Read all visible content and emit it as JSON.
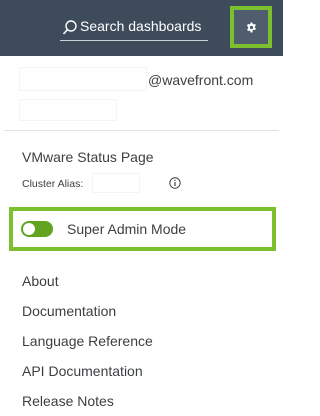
{
  "header": {
    "search_placeholder": "Search dashboards",
    "settings_icon": "gear-icon"
  },
  "account": {
    "email_suffix": "@wavefront.com"
  },
  "status": {
    "status_page_label": "VMware Status Page",
    "cluster_alias_label": "Cluster Alias:"
  },
  "admin_mode": {
    "label": "Super Admin Mode",
    "enabled": true
  },
  "menu_links": [
    "About",
    "Documentation",
    "Language Reference",
    "API Documentation",
    "Release Notes"
  ],
  "colors": {
    "topbar": "#3e4b5b",
    "highlight": "#7cbf2f",
    "toggle_on": "#62a420"
  }
}
